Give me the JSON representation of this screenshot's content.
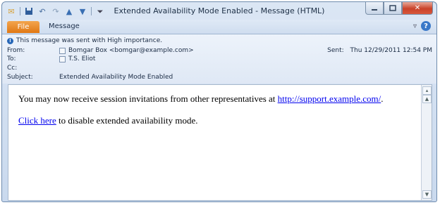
{
  "window": {
    "title": "Extended Availability Mode Enabled  -  Message (HTML)"
  },
  "qat": {
    "icons": [
      "mail-icon",
      "save-icon",
      "undo-icon",
      "redo-icon",
      "up-arrow-icon",
      "down-arrow-icon",
      "customize-icon"
    ]
  },
  "ribbon": {
    "file_tab": "File",
    "message_tab": "Message"
  },
  "header": {
    "notice": "This message was sent with High importance.",
    "from_label": "From:",
    "from_value": "Bomgar Box <bomgar@example.com>",
    "to_label": "To:",
    "to_value": "T.S. Eliot",
    "cc_label": "Cc:",
    "subject_label": "Subject:",
    "subject_value": "Extended Availability Mode Enabled",
    "sent_label": "Sent:",
    "sent_value": "Thu 12/29/2011 12:54 PM"
  },
  "body": {
    "line1_text": "You may now receive session invitations from other representatives at ",
    "line1_link": "http://support.example.com/",
    "line1_end": ".",
    "line2_link": "Click here",
    "line2_text": " to disable extended availability mode."
  },
  "colors": {
    "file_tab": "#e07814",
    "link": "#0000ee",
    "info": "#2767b7"
  }
}
